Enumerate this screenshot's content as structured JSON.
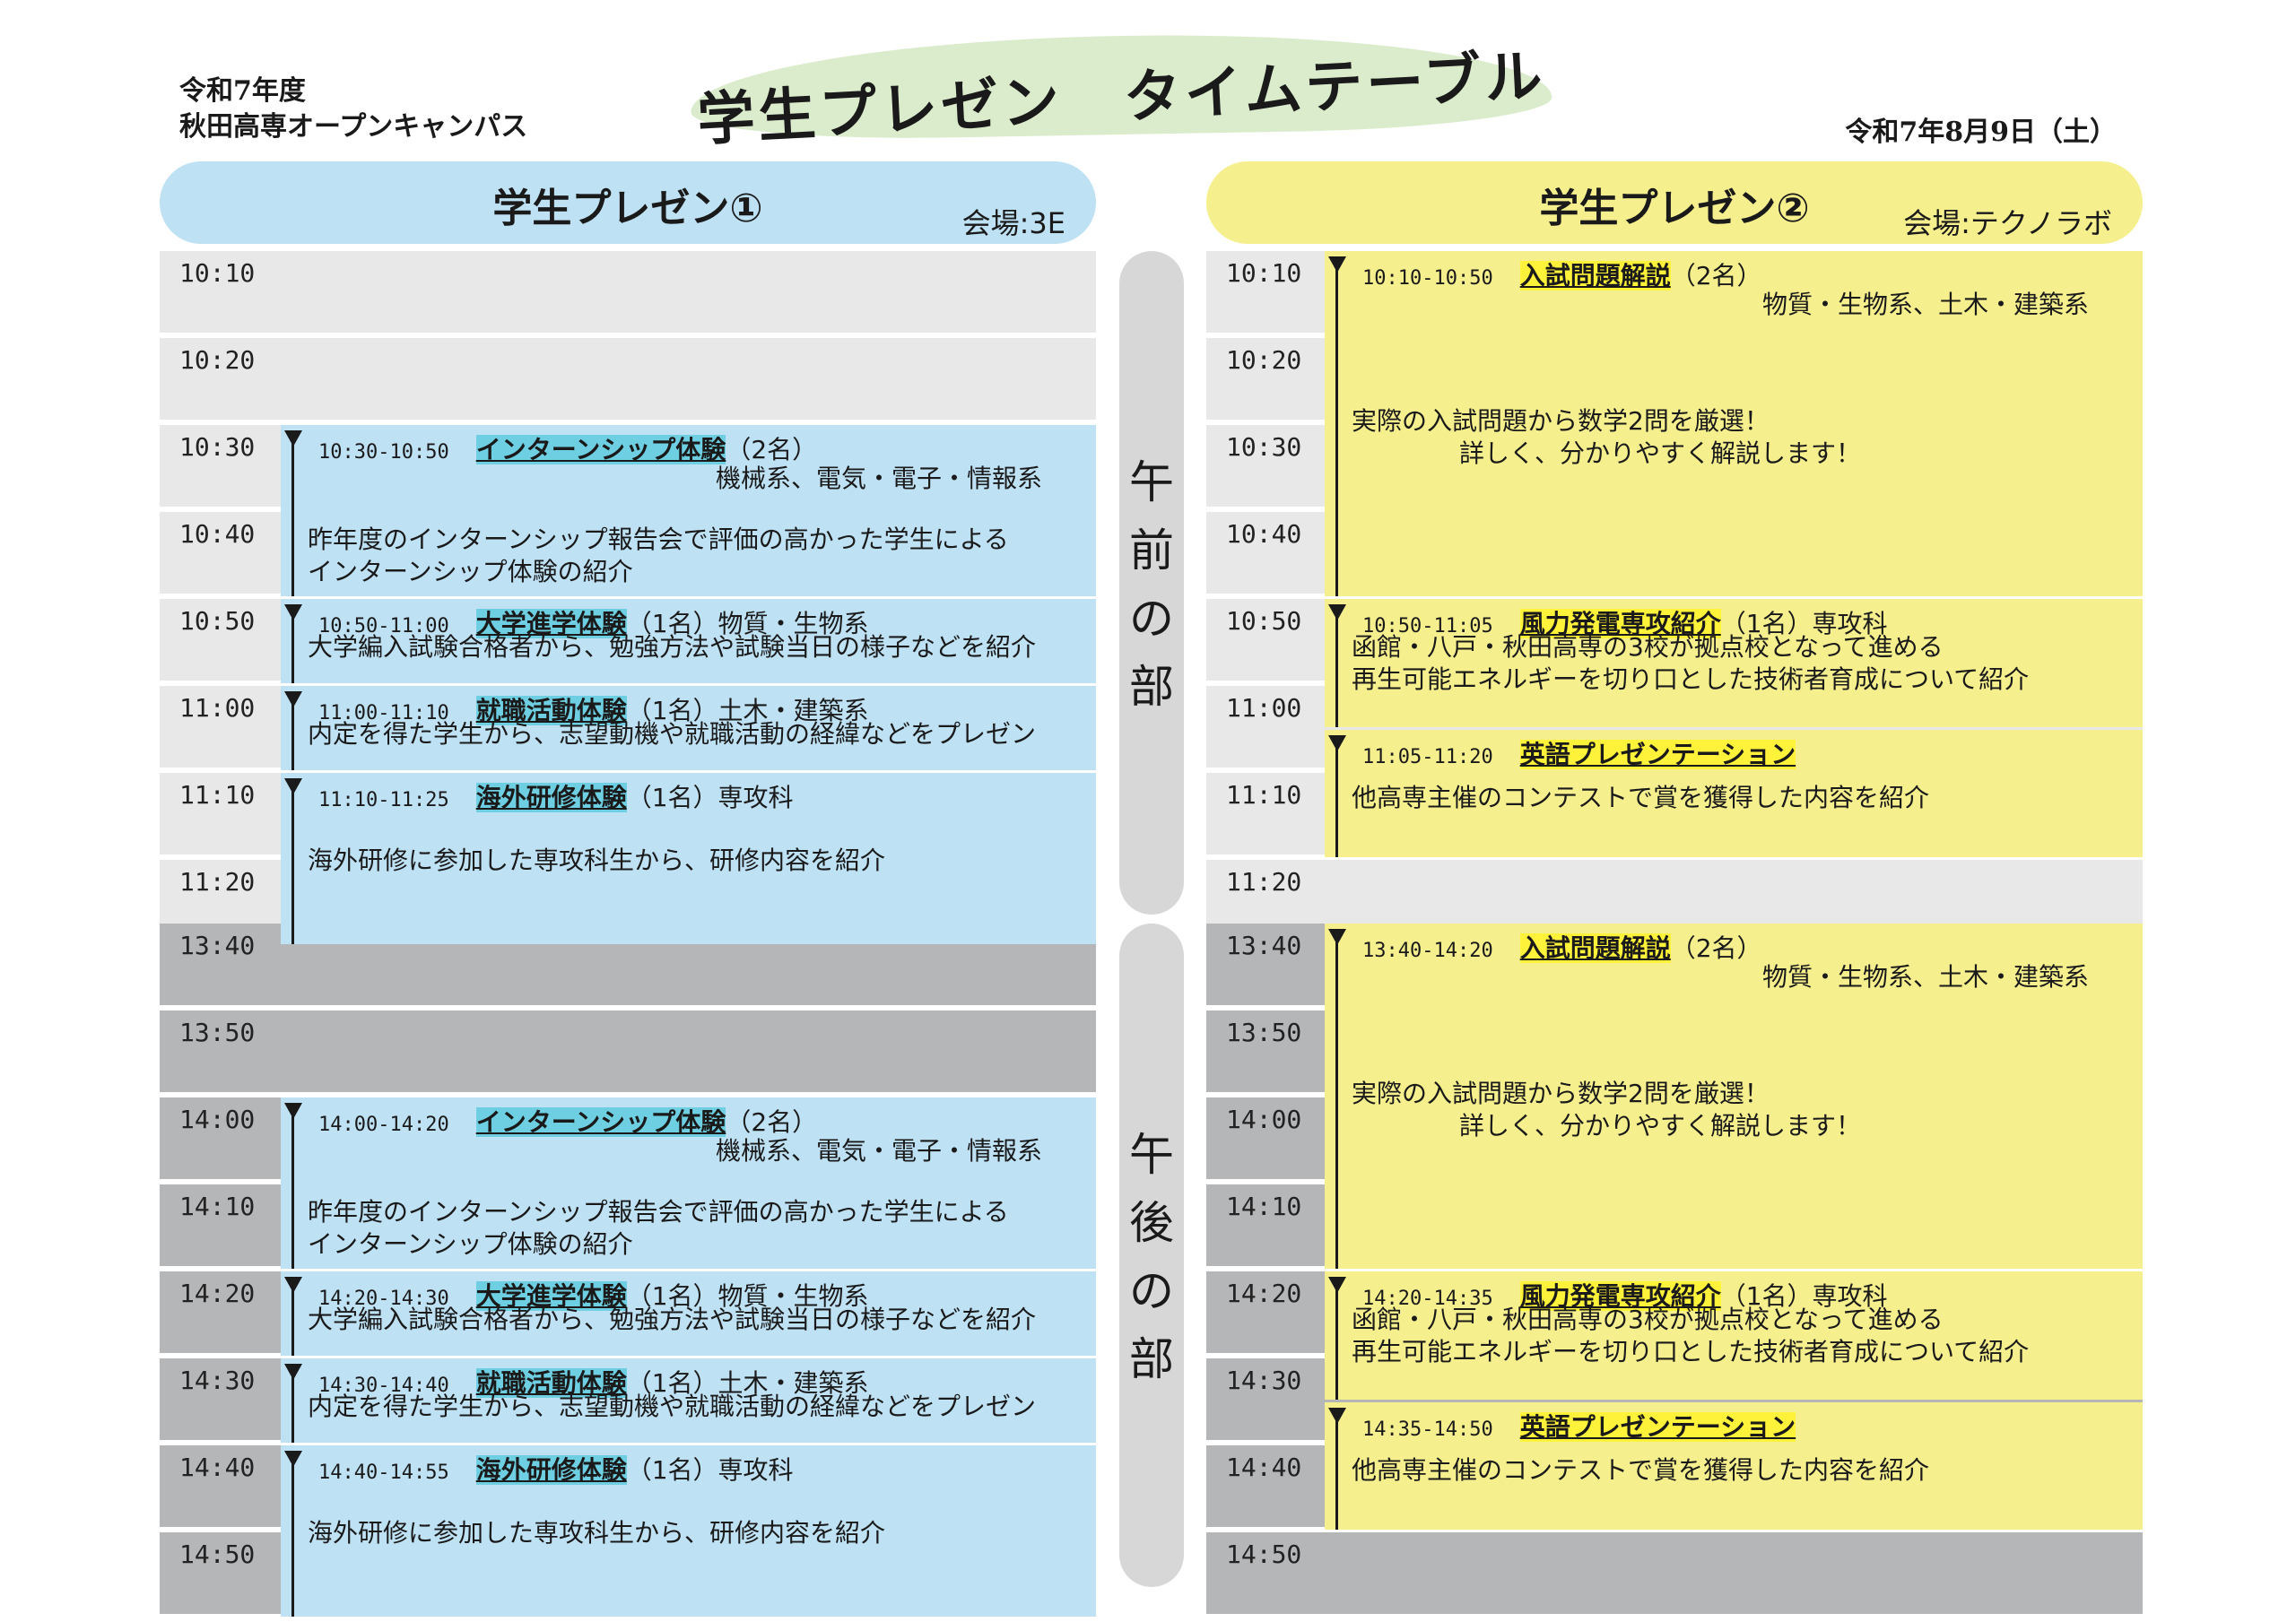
{
  "header": {
    "left_line1": "令和7年度",
    "left_line2": "秋田高専オープンキャンパス",
    "title": "学生プレゼン　タイムテーブル",
    "date": "令和7年8月9日（土）"
  },
  "venue1": {
    "title": "学生プレゼン①",
    "room": "会場:3E"
  },
  "venue2": {
    "title": "学生プレゼン②",
    "room": "会場:テクノラボ"
  },
  "periods": {
    "am": [
      "午",
      "前",
      "の",
      "部"
    ],
    "pm": [
      "午",
      "後",
      "の",
      "部"
    ]
  },
  "am_times": [
    "10:10",
    "10:20",
    "10:30",
    "10:40",
    "10:50",
    "11:00",
    "11:10",
    "11:20"
  ],
  "pm_times": [
    "13:40",
    "13:50",
    "14:00",
    "14:10",
    "14:20",
    "14:30",
    "14:40",
    "14:50"
  ],
  "v1_am": [
    {
      "time": "10:30-10:50",
      "name": "インターンシップ体験",
      "count": "（2名）",
      "sub": "機械系、電気・電子・情報系",
      "desc1": "昨年度のインターンシップ報告会で評価の高かった学生による",
      "desc2": "インターンシップ体験の紹介"
    },
    {
      "time": "10:50-11:00",
      "name": "大学進学体験",
      "count": "（1名）物質・生物系",
      "desc1": "大学編入試験合格者から、勉強方法や試験当日の様子などを紹介"
    },
    {
      "time": "11:00-11:10",
      "name": "就職活動体験",
      "count": "（1名）土木・建築系",
      "desc1": "内定を得た学生から、志望動機や就職活動の経緯などをプレゼン"
    },
    {
      "time": "11:10-11:25",
      "name": "海外研修体験",
      "count": "（1名）専攻科",
      "desc1": "海外研修に参加した専攻科生から、研修内容を紹介"
    }
  ],
  "v1_pm": [
    {
      "time": "14:00-14:20",
      "name": "インターンシップ体験",
      "count": "（2名）",
      "sub": "機械系、電気・電子・情報系",
      "desc1": "昨年度のインターンシップ報告会で評価の高かった学生による",
      "desc2": "インターンシップ体験の紹介"
    },
    {
      "time": "14:20-14:30",
      "name": "大学進学体験",
      "count": "（1名）物質・生物系",
      "desc1": "大学編入試験合格者から、勉強方法や試験当日の様子などを紹介"
    },
    {
      "time": "14:30-14:40",
      "name": "就職活動体験",
      "count": "（1名）土木・建築系",
      "desc1": "内定を得た学生から、志望動機や就職活動の経緯などをプレゼン"
    },
    {
      "time": "14:40-14:55",
      "name": "海外研修体験",
      "count": "（1名）専攻科",
      "desc1": "海外研修に参加した専攻科生から、研修内容を紹介"
    }
  ],
  "v2_am": [
    {
      "time": "10:10-10:50",
      "name": "入試問題解説",
      "count": "（2名）",
      "sub": "物質・生物系、土木・建築系",
      "desc1": "実際の入試問題から数学2問を厳選！",
      "desc2": "詳しく、分かりやすく解説します！"
    },
    {
      "time": "10:50-11:05",
      "name": "風力発電専攻紹介",
      "count": "（1名）専攻科",
      "desc1": "函館・八戸・秋田高専の3校が拠点校となって進める",
      "desc2": "再生可能エネルギーを切り口とした技術者育成について紹介"
    },
    {
      "time": "11:05-11:20",
      "name": "英語プレゼンテーション",
      "count": "",
      "desc1": "他高専主催のコンテストで賞を獲得した内容を紹介"
    }
  ],
  "v2_pm": [
    {
      "time": "13:40-14:20",
      "name": "入試問題解説",
      "count": "（2名）",
      "sub": "物質・生物系、土木・建築系",
      "desc1": "実際の入試問題から数学2問を厳選！",
      "desc2": "詳しく、分かりやすく解説します！"
    },
    {
      "time": "14:20-14:35",
      "name": "風力発電専攻紹介",
      "count": "（1名）専攻科",
      "desc1": "函館・八戸・秋田高専の3校が拠点校となって進める",
      "desc2": "再生可能エネルギーを切り口とした技術者育成について紹介"
    },
    {
      "time": "14:35-14:50",
      "name": "英語プレゼンテーション",
      "count": "",
      "desc1": "他高専主催のコンテストで賞を獲得した内容を紹介"
    }
  ]
}
